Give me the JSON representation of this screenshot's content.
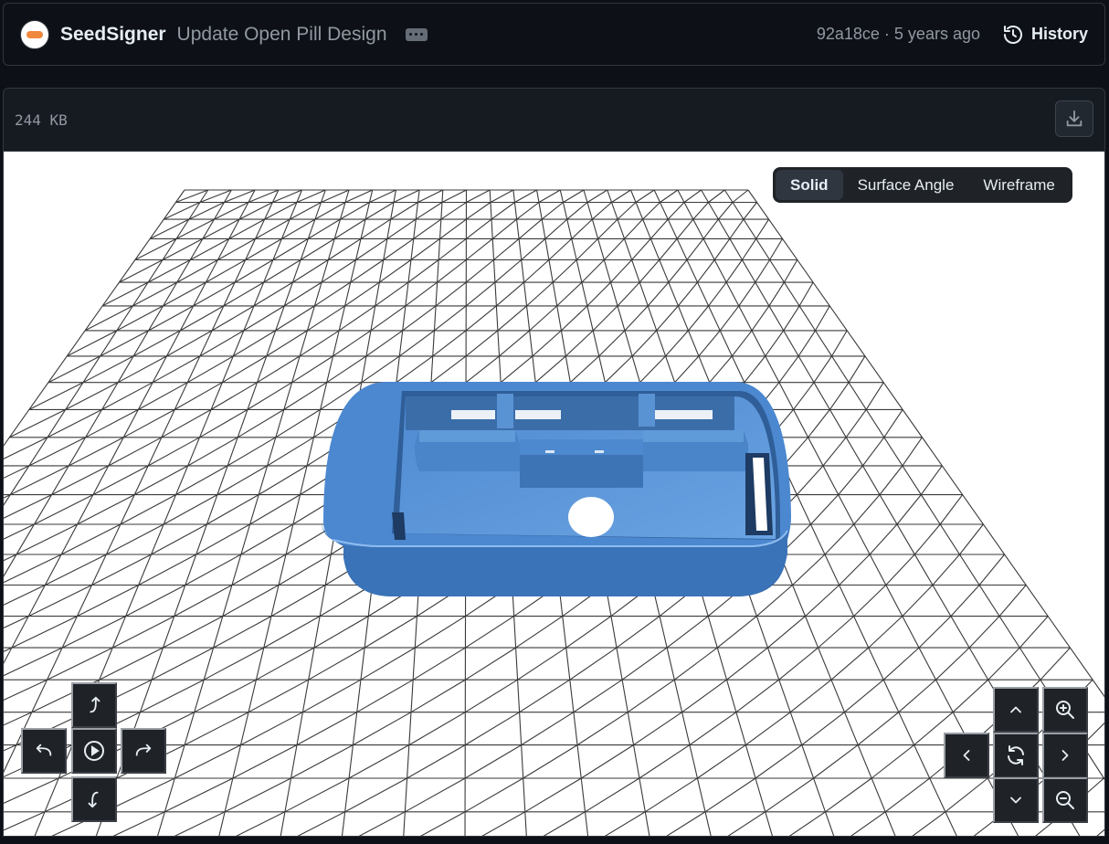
{
  "commit": {
    "author": "SeedSigner",
    "message": "Update Open Pill Design",
    "sha_time": "92a18ce · 5 years ago",
    "history_label": "History"
  },
  "file": {
    "size": "244  KB"
  },
  "viewer": {
    "modes": [
      {
        "label": "Solid",
        "active": true
      },
      {
        "label": "Surface Angle",
        "active": false
      },
      {
        "label": "Wireframe",
        "active": false
      }
    ],
    "model_color": "#4a86cf",
    "rotate_controls": [
      "rotate-up-icon",
      "rotate-left-icon",
      "play-icon",
      "rotate-right-icon",
      "rotate-down-icon"
    ],
    "pan_zoom_controls": [
      "chevron-up-icon",
      "zoom-in-icon",
      "chevron-left-icon",
      "reset-view-icon",
      "chevron-right-icon",
      "chevron-down-icon",
      "zoom-out-icon"
    ]
  }
}
